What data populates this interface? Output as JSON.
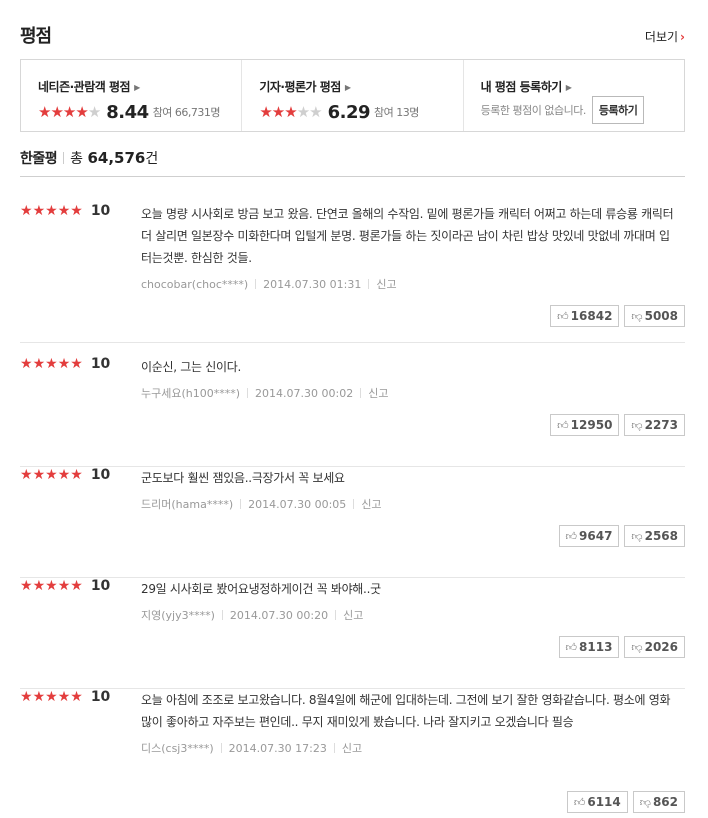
{
  "header": {
    "title": "평점",
    "more_label": "더보기"
  },
  "scores": {
    "netizen": {
      "title": "네티즌·관람객 평점",
      "stars": [
        1,
        1,
        1,
        1,
        0
      ],
      "score": "8.44",
      "participants": "참여 66,731명"
    },
    "critic": {
      "title": "기자·평론가 평점",
      "stars": [
        1,
        1,
        1,
        0,
        0
      ],
      "score": "6.29",
      "participants": "참여 13명"
    },
    "mine": {
      "title": "내 평점 등록하기",
      "desc": "등록한 평점이 없습니다.",
      "button": "등록하기"
    }
  },
  "summary": {
    "label": "한줄평",
    "total_prefix": "총",
    "total_count": "64,576",
    "total_suffix": "건"
  },
  "reviews": [
    {
      "stars": 5,
      "score": "10",
      "text": "오늘 명량 시사회로 방금 보고 왔음. 단연코 올해의 수작임. 밑에 평론가들 캐릭터 어쩌고 하는데 류승룡 캐릭터 더 살리면 일본장수 미화한다며 입털게 분명. 평론가들 하는 짓이라곤 남이 차린 밥상 맛있네 맛없네 까대며 입터는것뿐. 한심한 것들.",
      "user": "chocobar(choc****)",
      "date": "2014.07.30 01:31",
      "report": "신고",
      "likes": "16842",
      "dislikes": "5008"
    },
    {
      "stars": 5,
      "score": "10",
      "text": "이순신, 그는 신이다.",
      "user": "누구세요(h100****)",
      "date": "2014.07.30 00:02",
      "report": "신고",
      "likes": "12950",
      "dislikes": "2273"
    },
    {
      "stars": 5,
      "score": "10",
      "text": "군도보다 훨씬 잼있음..극장가서 꼭 보세요",
      "user": "드리머(hama****)",
      "date": "2014.07.30 00:05",
      "report": "신고",
      "likes": "9647",
      "dislikes": "2568"
    },
    {
      "stars": 5,
      "score": "10",
      "text": "29일 시사회로 봤어요냉정하게이건 꼭 봐야해..굿",
      "user": "지영(yjy3****)",
      "date": "2014.07.30 00:20",
      "report": "신고",
      "likes": "8113",
      "dislikes": "2026"
    },
    {
      "stars": 5,
      "score": "10",
      "text": "오늘 아침에 조조로 보고왔습니다. 8월4일에 해군에 입대하는데. 그전에 보기 잘한 영화같습니다. 평소에 영화 많이 좋아하고 자주보는 편인데.. 무지 재미있게 봤습니다. 나라 잘지키고 오겠습니다 필승",
      "user": "디스(csj3****)",
      "date": "2014.07.30 17:23",
      "report": "신고",
      "likes": "6114",
      "dislikes": "862"
    }
  ]
}
